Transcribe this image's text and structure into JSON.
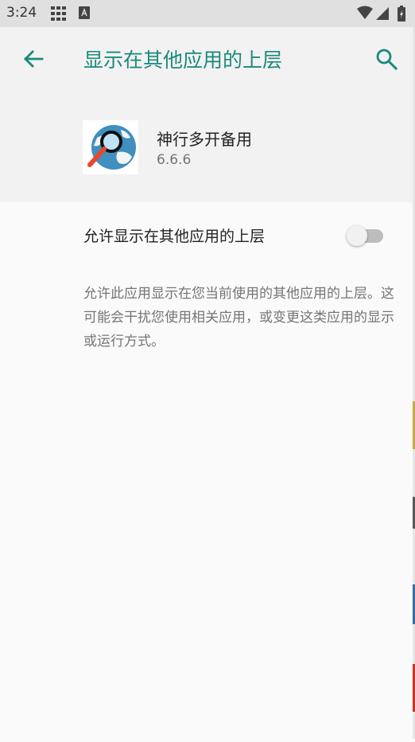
{
  "status_bar": {
    "time": "3:24",
    "icons": [
      "grid-icon",
      "a-icon",
      "wifi-icon",
      "signal-icon",
      "battery-icon"
    ]
  },
  "toolbar": {
    "title": "显示在其他应用的上层",
    "back_icon": "arrow-back-icon",
    "search_icon": "search-icon"
  },
  "app": {
    "name": "神行多开备用",
    "version": "6.6.6",
    "icon": "globe-magnifier-icon"
  },
  "setting": {
    "label": "允许显示在其他应用的上层",
    "enabled": false
  },
  "description": "允许此应用显示在您当前使用的其他应用的上层。这可能会干扰您使用相关应用，或变更这类应用的显示或运行方式。",
  "colors": {
    "accent": "#1a8a7a",
    "status_bar_bg": "#e0e0e0",
    "header_bg": "#f2f2f2",
    "page_bg": "#fafafa"
  }
}
